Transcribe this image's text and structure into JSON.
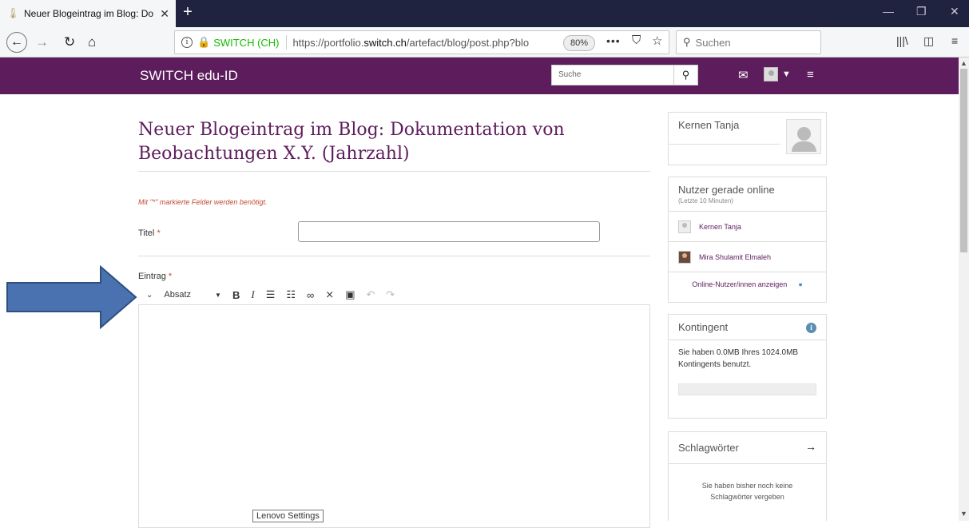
{
  "browser": {
    "tab_title": "Neuer Blogeintrag im Blog: Do",
    "org_name": "SWITCH (CH)",
    "url_prefix": "https://portfolio.",
    "url_domain": "switch.ch",
    "url_path": "/artefact/blog/post.php?blo",
    "zoom": "80%",
    "search_placeholder": "Suchen"
  },
  "site": {
    "brand": "SWITCH edu-ID",
    "search_placeholder": "Suche"
  },
  "main": {
    "page_title": "Neuer Blogeintrag im Blog: Dokumentation von Beobachtungen X.Y. (Jahrzahl)",
    "required_note": "Mit \"*\" markierte Felder werden benötigt.",
    "title_label": "Titel",
    "entry_label": "Eintrag",
    "required_mark": "*",
    "format_select": "Absatz",
    "tooltip": "Lenovo Settings"
  },
  "sidebar": {
    "user_name": "Kernen Tanja",
    "online_heading": "Nutzer gerade online",
    "online_sub": "(Letzte 10 Minuten)",
    "online_users": [
      "Kernen Tanja",
      "Mira Shulamit Elmaleh"
    ],
    "online_link": "Online-Nutzer/innen anzeigen",
    "quota_heading": "Kontingent",
    "quota_text": "Sie haben 0.0MB Ihres 1024.0MB Kontingents benutzt.",
    "quota_fraction": 0.0,
    "tags_heading": "Schlagwörter",
    "tags_empty": "Sie haben bisher noch keine Schlagwörter vergeben"
  },
  "colors": {
    "brand": "#5d1d5c",
    "required": "#c24a36",
    "arrow": "#4a72b0"
  }
}
